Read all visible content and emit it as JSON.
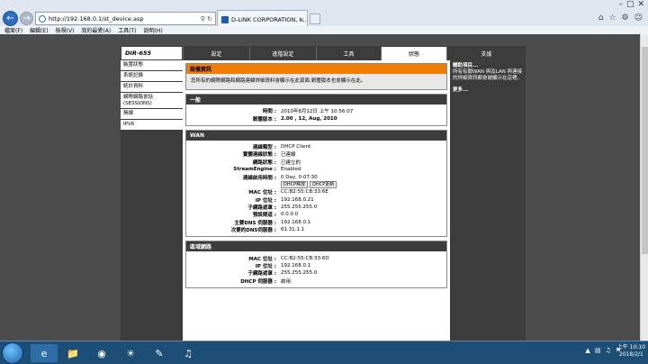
{
  "browser": {
    "url": "http://192.168.0.1/st_device.asp",
    "tab_title": "D-LINK CORPORATION, I...",
    "back_icon": "back-arrow-icon",
    "forward_icon": "forward-arrow-icon"
  },
  "menu": [
    "檔案(F)",
    "編輯(E)",
    "檢視(V)",
    "我的最愛(A)",
    "工具(T)",
    "說明(H)"
  ],
  "router": {
    "model": "DIR-655",
    "tabs": [
      "設定",
      "進階設定",
      "工具",
      "狀態",
      "支援"
    ],
    "active_tab": "狀態",
    "sidebar": [
      "裝置狀態",
      "系統記錄",
      "統計資料",
      "網際網路會話 (SESSIONS)",
      "無線",
      "IPV6"
    ],
    "device_info": {
      "title": "設備資訊",
      "description": "您所有的網際網路和網路連線詳細資料會顯示在此頁面,韌體版本也會顯示在此。"
    },
    "general": {
      "header": "一般",
      "rows": [
        {
          "k": "時間 :",
          "v": "2010年8月12日 上午 10:56:07"
        },
        {
          "k": "韌體版本 :",
          "v": "2.00 , 12, Aug, 2010"
        }
      ]
    },
    "wan": {
      "header": "WAN",
      "rows": [
        {
          "k": "連線類型 :",
          "v": "DHCP Client"
        },
        {
          "k": "實體連線狀態 :",
          "v": "已連線"
        },
        {
          "k": "網路狀態 :",
          "v": "已建立的"
        },
        {
          "k": "StreamEngine :",
          "v": "Enabled"
        },
        {
          "k": "連線啟用時間 :",
          "v": "0 Day, 0:07:30"
        },
        {
          "k": "",
          "v": ""
        },
        {
          "k": "MAC 位址 :",
          "v": "CC:B2:55:CB:33:6E"
        },
        {
          "k": "IP 位址 :",
          "v": "192.168.0.21"
        },
        {
          "k": "子網路遮罩 :",
          "v": "255.255.255.0"
        },
        {
          "k": "預設閘道 :",
          "v": "0.0.0.0"
        },
        {
          "k": "主要DNS 伺服器 :",
          "v": "192.168.0.1"
        },
        {
          "k": "次要的DNS伺服器 :",
          "v": "61.31.1.1"
        }
      ],
      "buttons": [
        "DHCP釋放",
        "DHCP更新"
      ]
    },
    "lan": {
      "header": "區域網路",
      "rows": [
        {
          "k": "MAC 位址 :",
          "v": "CC:B2:55:CB:33:6D"
        },
        {
          "k": "IP 位址 :",
          "v": "192.168.0.1"
        },
        {
          "k": "子網路遮罩 :",
          "v": "255.255.255.0"
        },
        {
          "k": "DHCP 伺服器 :",
          "v": "啟用"
        }
      ]
    },
    "help": {
      "title": "輔助項目...",
      "text": "所有有關WAN 與及LAN 與連接的詳細資訊都會被顯示在這裡。",
      "more": "更多..."
    }
  },
  "taskbar": {
    "time": "上午 10:10",
    "date": "2018/2/1"
  }
}
